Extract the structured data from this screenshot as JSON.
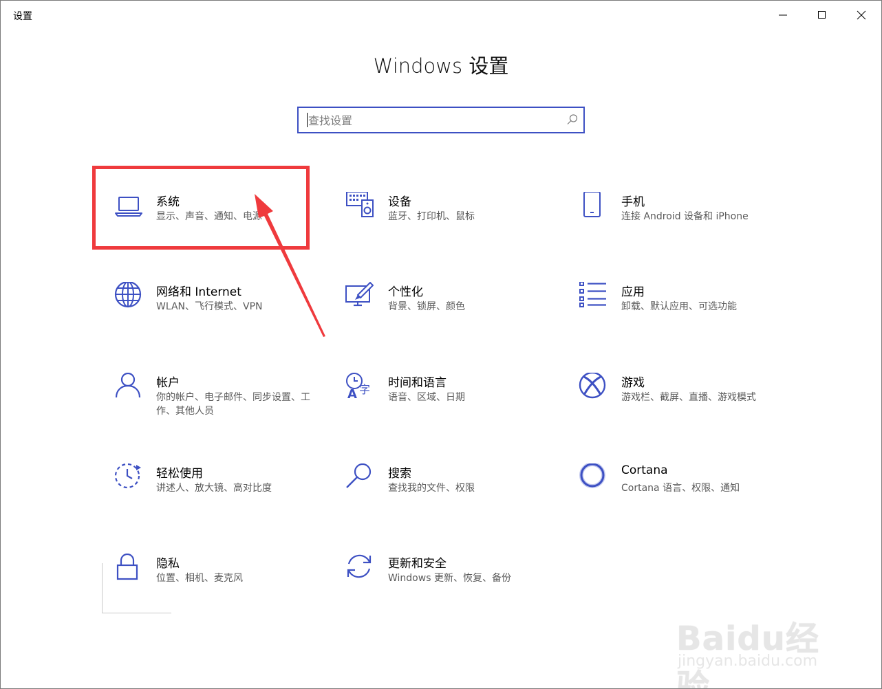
{
  "window": {
    "title": "设置",
    "controls": {
      "minimize": "minimize-icon",
      "maximize": "maximize-icon",
      "close": "close-icon"
    }
  },
  "header": {
    "title": "Windows 设置"
  },
  "search": {
    "placeholder": "查找设置",
    "value": ""
  },
  "accent_color": "#3d50c3",
  "highlight_color": "#ef3a3d",
  "tiles": [
    {
      "name": "系统",
      "desc": "显示、声音、通知、电源",
      "icon": "laptop-icon"
    },
    {
      "name": "设备",
      "desc": "蓝牙、打印机、鼠标",
      "icon": "keyboard-speaker-icon"
    },
    {
      "name": "手机",
      "desc": "连接 Android 设备和 iPhone",
      "icon": "phone-icon"
    },
    {
      "name": "网络和 Internet",
      "desc": "WLAN、飞行模式、VPN",
      "icon": "globe-icon"
    },
    {
      "name": "个性化",
      "desc": "背景、锁屏、颜色",
      "icon": "paint-icon"
    },
    {
      "name": "应用",
      "desc": "卸载、默认应用、可选功能",
      "icon": "apps-list-icon"
    },
    {
      "name": "帐户",
      "desc": "你的帐户、电子邮件、同步设置、工作、其他人员",
      "icon": "person-icon"
    },
    {
      "name": "时间和语言",
      "desc": "语音、区域、日期",
      "icon": "time-language-icon"
    },
    {
      "name": "游戏",
      "desc": "游戏栏、截屏、直播、游戏模式",
      "icon": "xbox-icon"
    },
    {
      "name": "轻松使用",
      "desc": "讲述人、放大镜、高对比度",
      "icon": "ease-of-access-icon"
    },
    {
      "name": "搜索",
      "desc": "查找我的文件、权限",
      "icon": "search-magnifier-icon"
    },
    {
      "name": "Cortana",
      "desc": "Cortana 语言、权限、通知",
      "icon": "cortana-icon"
    },
    {
      "name": "隐私",
      "desc": "位置、相机、麦克风",
      "icon": "lock-icon"
    },
    {
      "name": "更新和安全",
      "desc": "Windows 更新、恢复、备份",
      "icon": "refresh-icon"
    }
  ],
  "watermark": {
    "logo": "Baidu经验",
    "url": "jingyan.baidu.com"
  }
}
